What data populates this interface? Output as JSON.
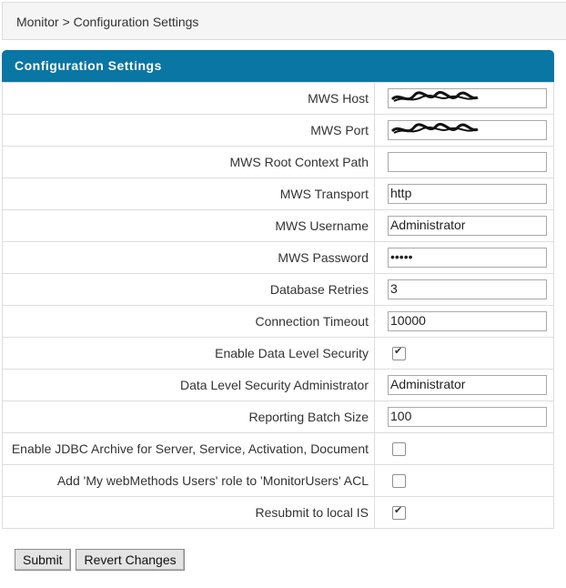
{
  "breadcrumb": {
    "root": "Monitor",
    "sep": ">",
    "current": "Configuration Settings"
  },
  "panel": {
    "title": "Configuration Settings"
  },
  "rows": [
    {
      "label": "MWS Host",
      "type": "text",
      "value": "",
      "redacted": true
    },
    {
      "label": "MWS Port",
      "type": "text",
      "value": "",
      "redacted": true
    },
    {
      "label": "MWS Root Context Path",
      "type": "text",
      "value": ""
    },
    {
      "label": "MWS Transport",
      "type": "text",
      "value": "http"
    },
    {
      "label": "MWS Username",
      "type": "text",
      "value": "Administrator"
    },
    {
      "label": "MWS Password",
      "type": "password",
      "value": "•••••"
    },
    {
      "label": "Database Retries",
      "type": "text",
      "value": "3"
    },
    {
      "label": "Connection Timeout",
      "type": "text",
      "value": "10000"
    },
    {
      "label": "Enable Data Level Security",
      "type": "checkbox",
      "checked": true
    },
    {
      "label": "Data Level Security Administrator",
      "type": "text",
      "value": "Administrator"
    },
    {
      "label": "Reporting Batch Size",
      "type": "text",
      "value": "100"
    },
    {
      "label": "Enable JDBC Archive for Server, Service, Activation, Document",
      "type": "checkbox",
      "checked": false
    },
    {
      "label": "Add 'My webMethods Users' role to 'MonitorUsers' ACL",
      "type": "checkbox",
      "checked": false
    },
    {
      "label": "Resubmit to local IS",
      "type": "checkbox",
      "checked": true
    }
  ],
  "buttons": {
    "submit": "Submit",
    "revert": "Revert Changes"
  },
  "colors": {
    "header": "#0a76a3",
    "border": "#dddddd",
    "breadcrumb_bg": "#f5f5f5"
  }
}
